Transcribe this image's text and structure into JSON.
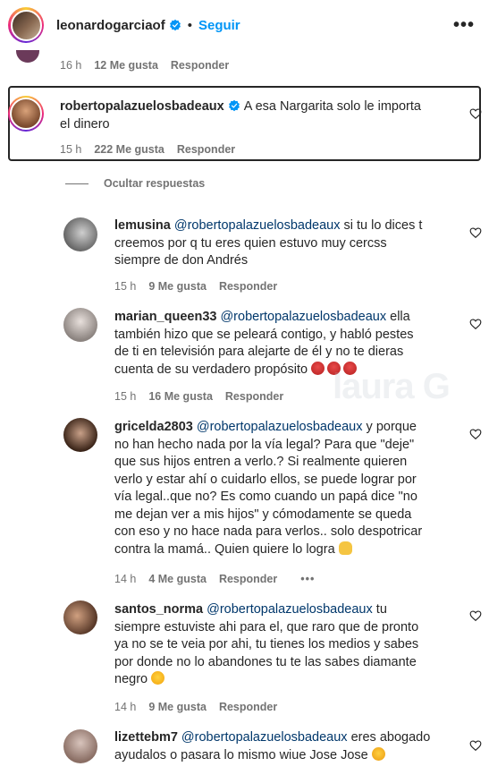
{
  "header": {
    "username": "leonardogarciaof",
    "dot": "•",
    "follow_label": "Seguir",
    "more_label": "•••"
  },
  "prev_comment": {
    "time": "16 h",
    "likes": "12 Me gusta",
    "reply": "Responder"
  },
  "main_comment": {
    "username": "robertopalazuelosbadeaux",
    "text_line1": "A esa Nargarita solo le importa",
    "text_line2": "el dinero",
    "time": "15 h",
    "likes": "222 Me gusta",
    "reply": "Responder"
  },
  "hide_replies_label": "Ocultar respuestas",
  "replies": [
    {
      "username": "lemusina",
      "mention": "@robertopalazuelosbadeaux",
      "line1": "si tu lo dices t",
      "line2": "creemos por q tu eres quien estuvo muy cercss",
      "line3": "siempre de don Andrés",
      "time": "15 h",
      "likes": "9 Me gusta",
      "reply": "Responder"
    },
    {
      "username": "marian_queen33",
      "mention": "@robertopalazuelosbadeaux",
      "line1": "ella",
      "line2": "también hizo que se peleará contigo, y habló pestes",
      "line3": "de ti en televisión para alejarte de él y no te dieras",
      "line4": "cuenta de su verdadero propósito",
      "time": "15 h",
      "likes": "16 Me gusta",
      "reply": "Responder"
    },
    {
      "username": "gricelda2803",
      "mention": "@robertopalazuelosbadeaux",
      "line1": "y porque",
      "line2": "no han hecho nada por la vía legal? Para que \"deje\"",
      "line3": "que sus hijos entren a verlo.? Si realmente quieren",
      "line4": "verlo y estar ahí o cuidarlo ellos, se puede lograr por",
      "line5": "vía legal..que no? Es como cuando un papá dice \"no",
      "line6": "me dejan ver a mis hijos\" y cómodamente se queda",
      "line7": "con eso y no hace nada para verlos.. solo despotricar",
      "line8": "contra la mamá.. Quien quiere lo logra",
      "time": "14 h",
      "likes": "4 Me gusta",
      "reply": "Responder",
      "more": "•••"
    },
    {
      "username": "santos_norma",
      "mention": "@robertopalazuelosbadeaux",
      "line1": "tu",
      "line2": "siempre estuviste ahi para el, que raro que de pronto",
      "line3": "ya no se te veia por ahi, tu tienes los medios y sabes",
      "line4": "por donde no lo abandones tu te las sabes diamante",
      "line5": "negro",
      "time": "14 h",
      "likes": "9 Me gusta",
      "reply": "Responder"
    },
    {
      "username": "lizettebm7",
      "mention": "@robertopalazuelosbadeaux",
      "line1": "eres abogado",
      "line2": "ayudalos o pasara lo mismo wiue Jose Jose"
    }
  ],
  "watermark": "laura G",
  "colors": {
    "link_blue": "#0095f6",
    "mention_blue": "#00376b",
    "meta_gray": "#737373",
    "text": "#262626"
  },
  "icons": {
    "verified": "verified-badge-icon",
    "heart": "heart-outline-icon",
    "more": "more-horizontal-icon"
  }
}
